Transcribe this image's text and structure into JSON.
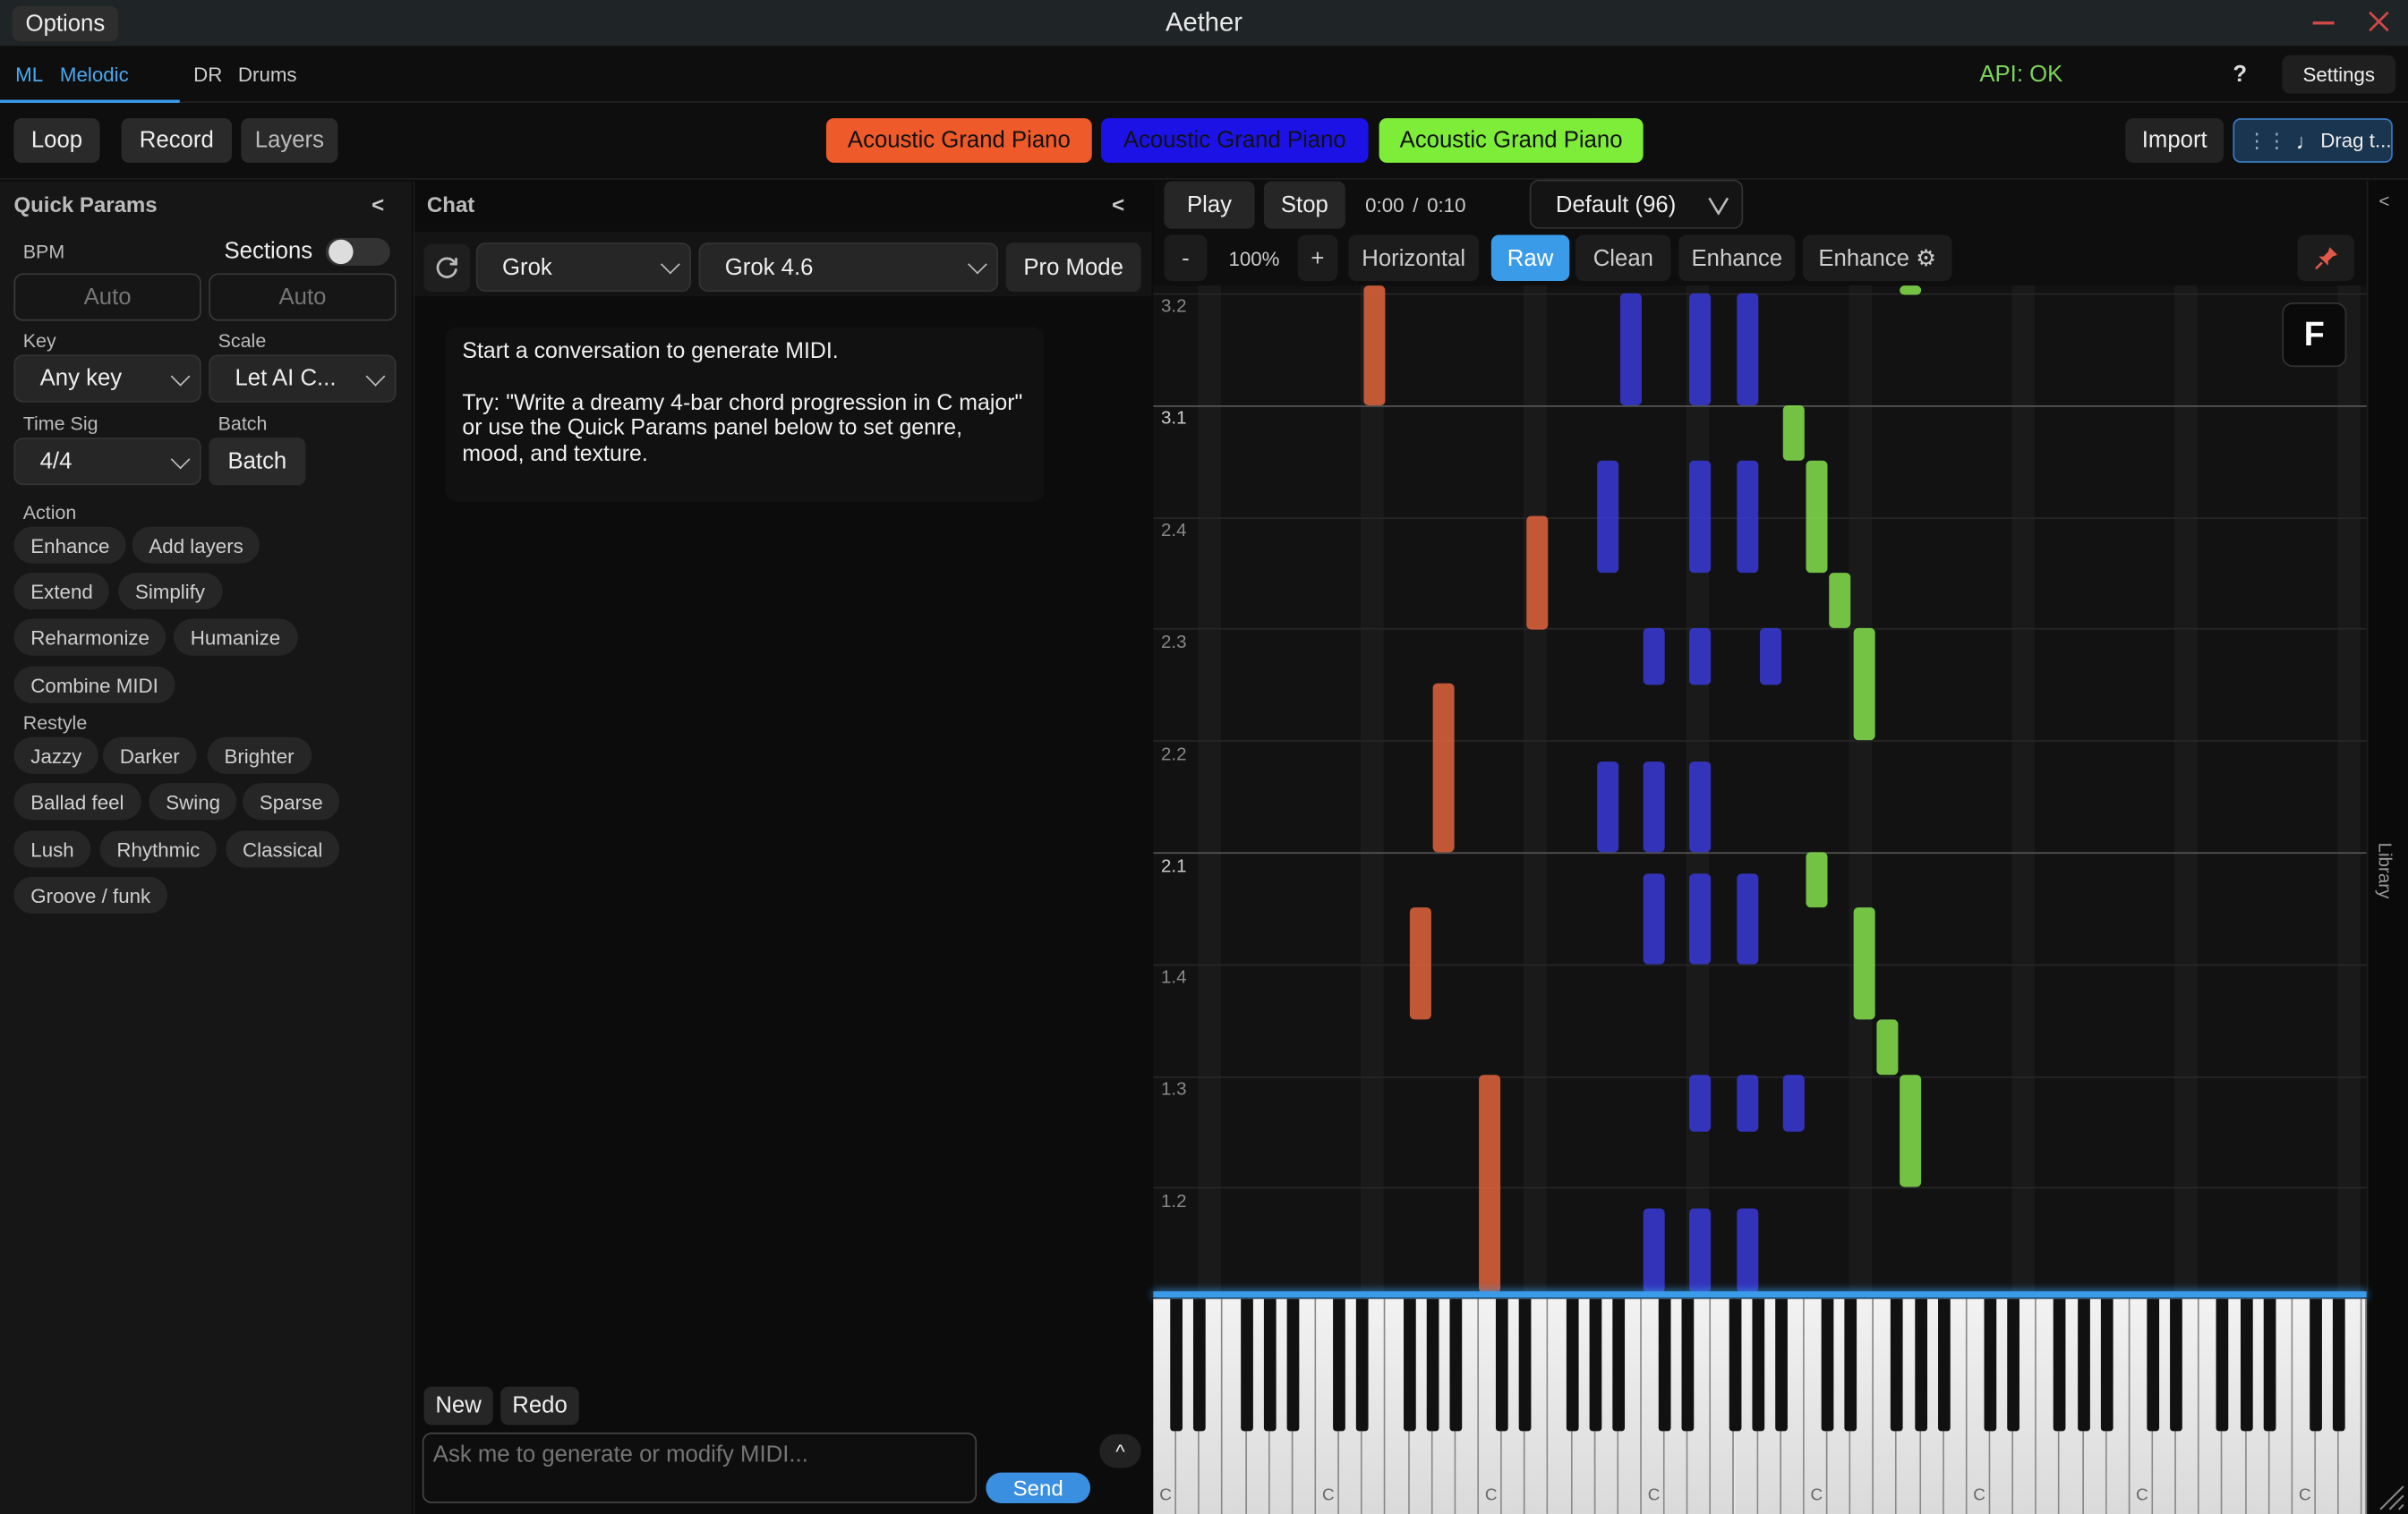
{
  "window": {
    "menu": "Options",
    "title": "Aether"
  },
  "tabs": {
    "ml_short": "ML",
    "ml_label": "Melodic",
    "dr_short": "DR",
    "dr_label": "Drums"
  },
  "status": {
    "api": "API: OK",
    "api_color": "#7cd35a"
  },
  "header": {
    "help": "?",
    "settings": "Settings"
  },
  "toolbar": {
    "loop": "Loop",
    "record": "Record",
    "layers": "Layers",
    "instruments": [
      {
        "label": "Acoustic Grand Piano",
        "color": "#ee5a2a"
      },
      {
        "label": "Acoustic Grand Piano",
        "color": "#1c12e6"
      },
      {
        "label": "Acoustic Grand Piano",
        "color": "#7eed3a"
      }
    ],
    "import": "Import",
    "drag": "Drag t..."
  },
  "quick_params": {
    "title": "Quick Params",
    "collapse": "<",
    "bpm_label": "BPM",
    "sections_label": "Sections",
    "bpm_placeholder_1": "Auto",
    "bpm_placeholder_2": "Auto",
    "key_label": "Key",
    "key_value": "Any key",
    "scale_label": "Scale",
    "scale_value": "Let AI C...",
    "timesig_label": "Time Sig",
    "timesig_value": "4/4",
    "batch_label": "Batch",
    "batch_button": "Batch",
    "action_label": "Action",
    "actions": [
      "Enhance",
      "Add layers",
      "Extend",
      "Simplify",
      "Reharmonize",
      "Humanize",
      "Combine MIDI"
    ],
    "restyle_label": "Restyle",
    "restyles": [
      "Jazzy",
      "Darker",
      "Brighter",
      "Ballad feel",
      "Swing",
      "Sparse",
      "Lush",
      "Rhythmic",
      "Classical",
      "Groove / funk"
    ]
  },
  "chat": {
    "title": "Chat",
    "collapse": "<",
    "provider": "Grok",
    "model": "Grok 4.6",
    "pro_mode": "Pro Mode",
    "intro_1": "Start a conversation to generate MIDI.",
    "intro_2": "Try: \"Write a dreamy 4-bar chord progression in C major\"",
    "intro_3": "or use the Quick Params panel below to set genre, mood, and texture.",
    "new": "New",
    "redo": "Redo",
    "input_placeholder": "Ask me to generate or modify MIDI...",
    "send": "Send",
    "expand": "^"
  },
  "transport": {
    "play": "Play",
    "stop": "Stop",
    "time_current": "0:00",
    "time_sep": "/",
    "time_total": "0:10",
    "preset": "Default (96)"
  },
  "view": {
    "zoom_out": "-",
    "zoom": "100%",
    "zoom_in": "+",
    "horizontal": "Horizontal",
    "raw": "Raw",
    "clean": "Clean",
    "enhance": "Enhance",
    "enhance_settings": "Enhance ⚙",
    "f_badge": "F",
    "library": "Library",
    "side_collapse": "<"
  },
  "roll": {
    "row_labels": [
      "3.2",
      "3.1",
      "2.4",
      "2.3",
      "2.2",
      "2.1",
      "1.4",
      "1.3",
      "1.2"
    ],
    "c_label": "C"
  }
}
